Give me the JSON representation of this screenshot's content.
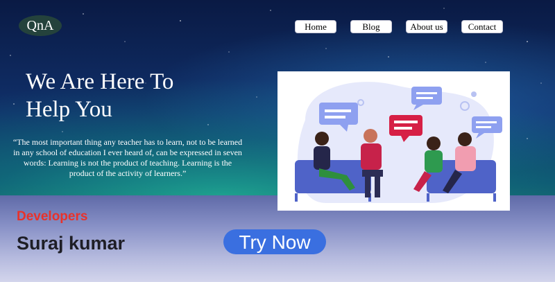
{
  "brand": {
    "logo_text": "QnA"
  },
  "nav": {
    "items": [
      {
        "label": "Home"
      },
      {
        "label": "Blog"
      },
      {
        "label": "About us"
      },
      {
        "label": "Contact"
      }
    ]
  },
  "hero": {
    "headline_line1": "We Are Here To",
    "headline_line2": "Help You",
    "quote": "“The most important thing any teacher has to learn, not to be learned in any school of education I ever heard of, can be expressed in seven words: Learning is not the product of teaching. Learning is the product of the activity of learners.”",
    "cta_label": "Try Now"
  },
  "developers": {
    "label": "Developers",
    "name": "Suraj kumar"
  },
  "colors": {
    "accent_red": "#e8322b",
    "cta_blue": "#3a6fe0",
    "logo_bg": "#24423c"
  },
  "illustration": {
    "icon": "group-discussion-illustration"
  }
}
